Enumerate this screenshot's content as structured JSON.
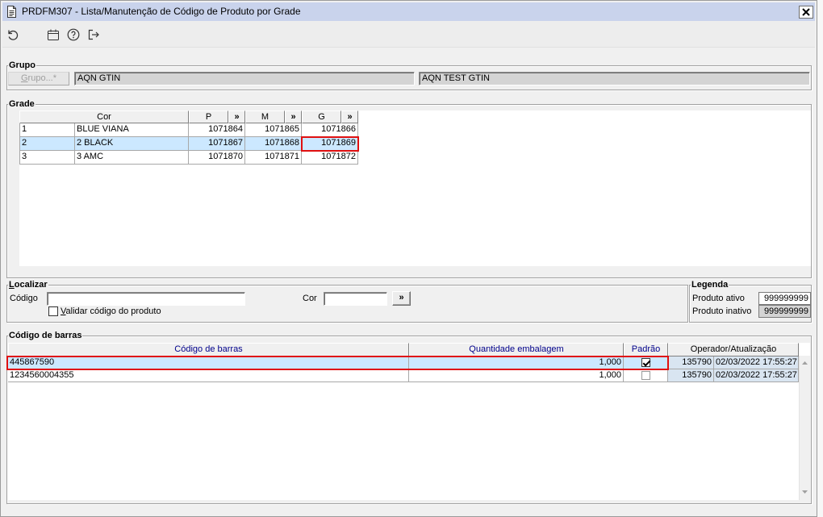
{
  "window": {
    "title": "PRDFM307 - Lista/Manutenção de Código de Produto por Grade",
    "title_icon": "document-icon",
    "close_icon": "close-icon"
  },
  "toolbar": {
    "buttons": [
      {
        "icon": "undo-icon"
      },
      {
        "icon": "calendar-icon"
      },
      {
        "icon": "help-icon"
      },
      {
        "icon": "exit-icon"
      }
    ]
  },
  "grupo": {
    "label": "Grupo",
    "button_label": "Grupo...*",
    "codigo": "AQN GTIN",
    "descricao": "AQN TEST GTIN"
  },
  "grade": {
    "label": "Grade",
    "headers": {
      "cor": "Cor",
      "sizes": [
        "P",
        "M",
        "G"
      ],
      "expand": "»"
    },
    "rows": [
      {
        "num": "1",
        "cor": "BLUE VIANA",
        "p": "1071864",
        "m": "1071865",
        "g": "1071866",
        "selected": false
      },
      {
        "num": "2",
        "cor": "2 BLACK",
        "p": "1071867",
        "m": "1071868",
        "g": "1071869",
        "selected": true,
        "g_focused": true
      },
      {
        "num": "3",
        "cor": "3 AMC",
        "p": "1071870",
        "m": "1071871",
        "g": "1071872",
        "selected": false
      }
    ]
  },
  "localizar": {
    "label": "Localizar",
    "codigo_label": "Código",
    "codigo_value": "",
    "validar_label": "Validar código do produto",
    "validar_checked": false,
    "cor_label": "Cor",
    "cor_value": "",
    "search_button": "»"
  },
  "legenda": {
    "label": "Legenda",
    "ativo_label": "Produto ativo",
    "ativo_sample": "999999999",
    "inativo_label": "Produto inativo",
    "inativo_sample": "999999999"
  },
  "barras": {
    "label": "Código de barras",
    "headers": {
      "codigo": "Código de barras",
      "quantidade": "Quantidade embalagem",
      "padrao": "Padrão",
      "operador": "Operador/Atualização"
    },
    "rows": [
      {
        "codigo": "445867590",
        "quantidade": "1,000",
        "padrao": true,
        "operador": "135790",
        "atualizacao": "02/03/2022 17:55:27",
        "selected": true
      },
      {
        "codigo": "1234560004355",
        "quantidade": "1,000",
        "padrao": false,
        "operador": "135790",
        "atualizacao": "02/03/2022 17:55:27",
        "selected": false
      }
    ]
  },
  "colors": {
    "titlebar": "#c9d3ec",
    "window_bg": "#f0f0f0",
    "selection": "#cce8ff",
    "focus_border": "#e01010",
    "header_text": "#00008b",
    "readonly_field": "#d4d4d4",
    "operator_cell": "#d9e5f1"
  }
}
